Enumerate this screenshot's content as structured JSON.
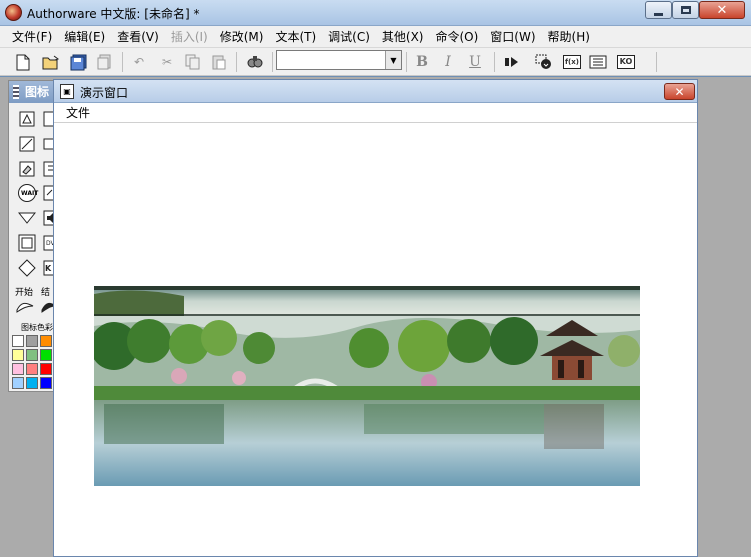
{
  "window": {
    "title": "Authorware 中文版: [未命名] *"
  },
  "menubar": {
    "items": [
      {
        "label": "文件(F)",
        "enabled": true
      },
      {
        "label": "编辑(E)",
        "enabled": true
      },
      {
        "label": "查看(V)",
        "enabled": true
      },
      {
        "label": "插入(I)",
        "enabled": false
      },
      {
        "label": "修改(M)",
        "enabled": true
      },
      {
        "label": "文本(T)",
        "enabled": true
      },
      {
        "label": "调试(C)",
        "enabled": true
      },
      {
        "label": "其他(X)",
        "enabled": true
      },
      {
        "label": "命令(O)",
        "enabled": true
      },
      {
        "label": "窗口(W)",
        "enabled": true
      },
      {
        "label": "帮助(H)",
        "enabled": true
      }
    ]
  },
  "toolbar": {
    "font_value": "",
    "bold": "B",
    "italic": "I",
    "underline": "U",
    "fn_label": "f(x)",
    "ko_label": "KO"
  },
  "palette": {
    "title": "图标",
    "start_label": "开始",
    "end_label": "结",
    "color_label": "图标色彩",
    "wait_label": "WAIT",
    "colors": [
      "#ffffff",
      "#a0a0a0",
      "#ff8c00",
      "#ffff99",
      "#80c080",
      "#00e000",
      "#ffc0e0",
      "#ff8080",
      "#ff0000",
      "#a0d0ff",
      "#00b0f0",
      "#0000ff"
    ]
  },
  "presentation": {
    "title": "演示窗口",
    "menu_file": "文件"
  },
  "colors": {
    "titlebar": "#b8cde8",
    "close_button": "#c9442c",
    "workspace": "#ababab"
  }
}
